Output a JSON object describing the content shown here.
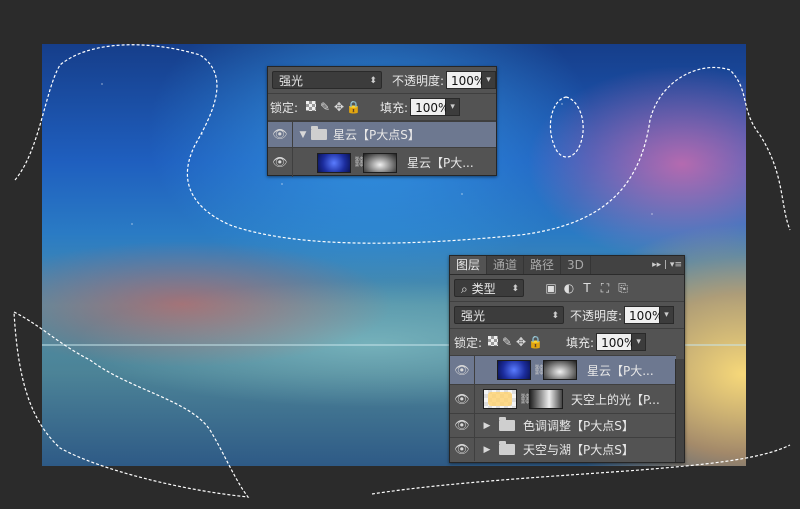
{
  "top_panel": {
    "blend_mode": "强光",
    "opacity_label": "不透明度:",
    "opacity_value": "100%",
    "lock_label": "锁定:",
    "fill_label": "填充:",
    "fill_value": "100%",
    "layers": [
      {
        "name": "星云【P大点S】",
        "type": "group"
      },
      {
        "name": "星云【P大...",
        "type": "layer"
      }
    ]
  },
  "layers_panel": {
    "tabs": [
      "图层",
      "通道",
      "路径",
      "3D"
    ],
    "filter_label": "类型",
    "blend_mode": "强光",
    "opacity_label": "不透明度:",
    "opacity_value": "100%",
    "lock_label": "锁定:",
    "fill_label": "填充:",
    "fill_value": "100%",
    "layers": [
      {
        "name": "星云【P大..."
      },
      {
        "name": "天空上的光【P..."
      },
      {
        "name": "色调调整【P大点S】"
      },
      {
        "name": "天空与湖【P大点S】"
      }
    ]
  },
  "colors": {
    "panel_bg": "#535353",
    "selected_row": "#6d7890",
    "app_bg": "#2b2b2b"
  }
}
